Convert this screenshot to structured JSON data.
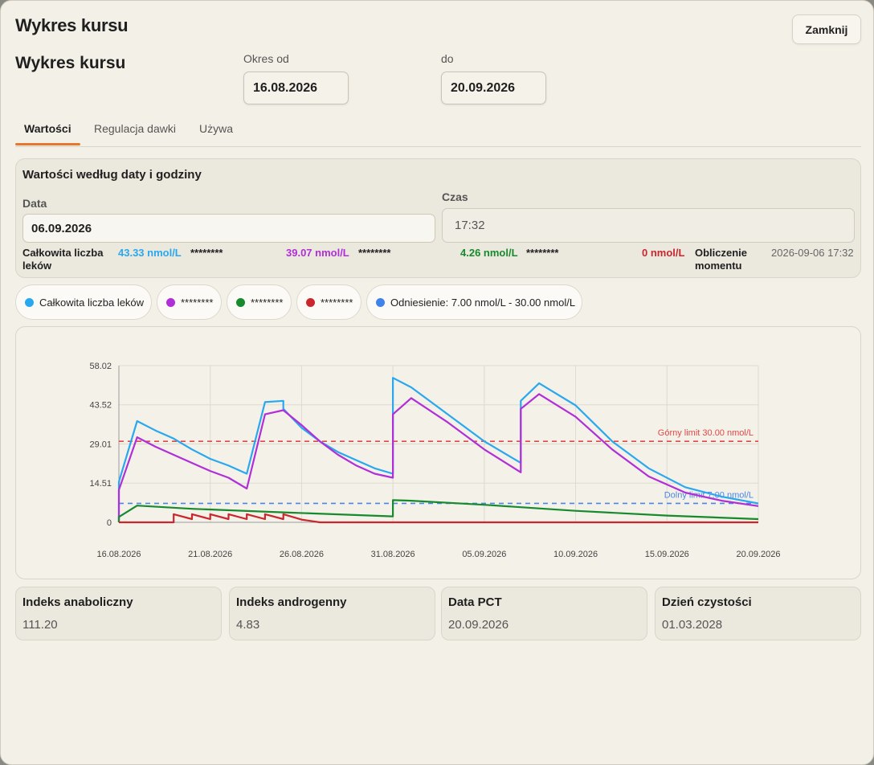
{
  "window": {
    "title": "Wykres kursu",
    "close_label": "Zamknij"
  },
  "header": {
    "heading": "Wykres kursu",
    "from_label": "Okres od",
    "from_value": "16.08.2026",
    "to_label": "do",
    "to_value": "20.09.2026"
  },
  "tabs": [
    {
      "label": "Wartości",
      "active": true
    },
    {
      "label": "Regulacja dawki",
      "active": false
    },
    {
      "label": "Używa",
      "active": false
    }
  ],
  "values_panel": {
    "title": "Wartości według daty i godziny",
    "date_label": "Data",
    "date_value": "06.09.2026",
    "time_label": "Czas",
    "time_value": "17:32",
    "total_label": "Całkowita liczba leków",
    "total_value": "43.33 nmol/L",
    "hidden1": "********",
    "v2": "39.07 nmol/L",
    "hidden2": "********",
    "v3": "4.26 nmol/L",
    "hidden3": "********",
    "v4": "0 nmol/L",
    "moment_label": "Obliczenie momentu",
    "moment_value": "2026-09-06 17:32"
  },
  "legend": [
    {
      "label": "Całkowita liczba leków",
      "color": "#29a8ef"
    },
    {
      "label": "********",
      "color": "#b02fd6"
    },
    {
      "label": "********",
      "color": "#168a2c"
    },
    {
      "label": "********",
      "color": "#c9262e"
    },
    {
      "label": "Odniesienie: 7.00 nmol/L - 30.00 nmol/L",
      "color": "#3f82ea"
    }
  ],
  "colors": {
    "total": "#29a8ef",
    "series2": "#b02fd6",
    "series3": "#168a2c",
    "series4": "#c9262e",
    "upper": "#e04848",
    "lower": "#4a86e8",
    "accent": "#e8772e"
  },
  "chart_data": {
    "type": "line",
    "ylim": [
      0,
      58.02
    ],
    "yticks": [
      "0",
      "14.51",
      "29.01",
      "43.52",
      "58.02"
    ],
    "xlim": [
      "16.08.2026",
      "20.09.2026"
    ],
    "xticks": [
      "16.08.2026",
      "21.08.2026",
      "26.08.2026",
      "31.08.2026",
      "05.09.2026",
      "10.09.2026",
      "15.09.2026",
      "20.09.2026"
    ],
    "grid": true,
    "reference_lines": [
      {
        "label": "Górny limit 30.00 nmol/L",
        "value": 30.0,
        "color": "#e04848"
      },
      {
        "label": "Dolny limit 7.00 nmol/L",
        "value": 7.0,
        "color": "#4a86e8"
      }
    ],
    "series": [
      {
        "color": "#29a8ef",
        "points": [
          [
            "16.08.2026",
            0
          ],
          [
            "16.08.2026",
            15
          ],
          [
            "17.08.2026",
            37.5
          ],
          [
            "18.08.2026",
            34
          ],
          [
            "19.08.2026",
            31
          ],
          [
            "20.08.2026",
            27
          ],
          [
            "21.08.2026",
            23.5
          ],
          [
            "22.08.2026",
            21
          ],
          [
            "23.08.2026",
            18
          ],
          [
            "24.08.2026",
            44.5
          ],
          [
            "25.08.2026",
            45
          ],
          [
            "25.08.2026",
            42
          ],
          [
            "26.08.2026",
            35
          ],
          [
            "27.08.2026",
            30
          ],
          [
            "28.08.2026",
            26
          ],
          [
            "29.08.2026",
            23
          ],
          [
            "30.08.2026",
            20
          ],
          [
            "31.08.2026",
            18
          ],
          [
            "31.08.2026",
            44
          ],
          [
            "31.08.2026",
            53.5
          ],
          [
            "01.09.2026",
            50
          ],
          [
            "03.09.2026",
            40
          ],
          [
            "05.09.2026",
            30
          ],
          [
            "07.09.2026",
            22
          ],
          [
            "07.09.2026",
            45
          ],
          [
            "08.09.2026",
            51.5
          ],
          [
            "10.09.2026",
            43.3
          ],
          [
            "12.09.2026",
            30
          ],
          [
            "14.09.2026",
            20
          ],
          [
            "16.09.2026",
            13
          ],
          [
            "18.09.2026",
            9.5
          ],
          [
            "20.09.2026",
            7
          ]
        ]
      },
      {
        "color": "#b02fd6",
        "points": [
          [
            "16.08.2026",
            0
          ],
          [
            "16.08.2026",
            12
          ],
          [
            "17.08.2026",
            31.5
          ],
          [
            "18.08.2026",
            28
          ],
          [
            "19.08.2026",
            25
          ],
          [
            "20.08.2026",
            22
          ],
          [
            "21.08.2026",
            19
          ],
          [
            "22.08.2026",
            16.5
          ],
          [
            "23.08.2026",
            12.5
          ],
          [
            "24.08.2026",
            40
          ],
          [
            "25.08.2026",
            41.5
          ],
          [
            "26.08.2026",
            36
          ],
          [
            "27.08.2026",
            30
          ],
          [
            "28.08.2026",
            25
          ],
          [
            "29.08.2026",
            21
          ],
          [
            "30.08.2026",
            18
          ],
          [
            "31.08.2026",
            16.5
          ],
          [
            "31.08.2026",
            40
          ],
          [
            "01.09.2026",
            46
          ],
          [
            "03.09.2026",
            37
          ],
          [
            "05.09.2026",
            27
          ],
          [
            "07.09.2026",
            18.5
          ],
          [
            "07.09.2026",
            42
          ],
          [
            "08.09.2026",
            47.5
          ],
          [
            "10.09.2026",
            39.07
          ],
          [
            "12.09.2026",
            27
          ],
          [
            "14.09.2026",
            17
          ],
          [
            "16.09.2026",
            11
          ],
          [
            "18.09.2026",
            8
          ],
          [
            "20.09.2026",
            6
          ]
        ]
      },
      {
        "color": "#168a2c",
        "points": [
          [
            "16.08.2026",
            0
          ],
          [
            "16.08.2026",
            2
          ],
          [
            "17.08.2026",
            6.2
          ],
          [
            "20.08.2026",
            5
          ],
          [
            "25.08.2026",
            3.7
          ],
          [
            "31.08.2026",
            2.2
          ],
          [
            "31.08.2026",
            8.2
          ],
          [
            "01.09.2026",
            8
          ],
          [
            "05.09.2026",
            6.5
          ],
          [
            "10.09.2026",
            4.26
          ],
          [
            "15.09.2026",
            2.5
          ],
          [
            "20.09.2026",
            1.2
          ]
        ]
      },
      {
        "color": "#c9262e",
        "points": [
          [
            "16.08.2026",
            0
          ],
          [
            "19.08.2026",
            0
          ],
          [
            "19.08.2026",
            3
          ],
          [
            "20.08.2026",
            1.2
          ],
          [
            "20.08.2026",
            3
          ],
          [
            "21.08.2026",
            1.2
          ],
          [
            "21.08.2026",
            3
          ],
          [
            "22.08.2026",
            1.2
          ],
          [
            "22.08.2026",
            3
          ],
          [
            "23.08.2026",
            1.2
          ],
          [
            "23.08.2026",
            3
          ],
          [
            "24.08.2026",
            1.2
          ],
          [
            "24.08.2026",
            3
          ],
          [
            "25.08.2026",
            1.2
          ],
          [
            "25.08.2026",
            3
          ],
          [
            "26.08.2026",
            1
          ],
          [
            "27.08.2026",
            0
          ],
          [
            "20.09.2026",
            0
          ]
        ]
      }
    ]
  },
  "stats": [
    {
      "label": "Indeks anaboliczny",
      "value": "111.20"
    },
    {
      "label": "Indeks androgenny",
      "value": "4.83"
    },
    {
      "label": "Data PCT",
      "value": "20.09.2026"
    },
    {
      "label": "Dzień czystości",
      "value": "01.03.2028"
    }
  ]
}
